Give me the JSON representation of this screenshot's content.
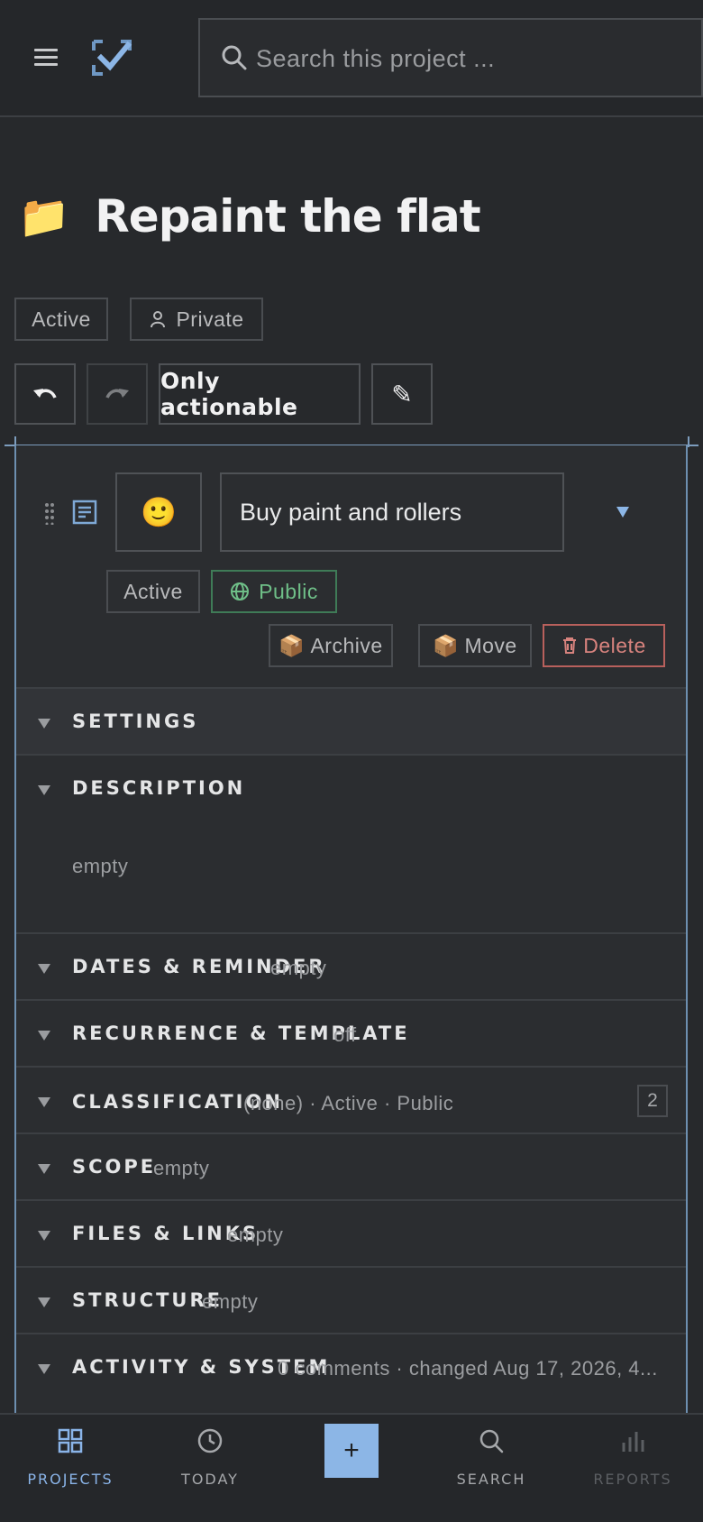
{
  "header": {
    "search_placeholder": "Search this project ..."
  },
  "project": {
    "title": "Repaint the flat",
    "status_chip": "Active",
    "visibility_chip": "Private"
  },
  "toolbar": {
    "filter_label": "Only actionable"
  },
  "task": {
    "name": "Buy paint and rollers",
    "emoji": "🙂",
    "status_chip": "Active",
    "visibility_chip": "Public",
    "archive_label": "Archive",
    "move_label": "Move",
    "delete_label": "Delete"
  },
  "sections": {
    "settings": {
      "title": "SETTINGS"
    },
    "description": {
      "title": "DESCRIPTION",
      "value": "empty"
    },
    "dates": {
      "title": "DATES & REMINDER",
      "value": "empty"
    },
    "recurrence": {
      "title": "RECURRENCE & TEMPLATE",
      "value": "off"
    },
    "classification": {
      "title": "CLASSIFICATION",
      "value": "(none) · Active · Public",
      "count": "2"
    },
    "scope": {
      "title": "SCOPE",
      "value": "empty"
    },
    "files": {
      "title": "FILES & LINKS",
      "value": "empty"
    },
    "structure": {
      "title": "STRUCTURE",
      "value": "empty"
    },
    "activity": {
      "title": "ACTIVITY & SYSTEM",
      "value": "0 comments · changed Aug 17, 2026, 4..."
    }
  },
  "nav": {
    "projects": "PROJECTS",
    "today": "TODAY",
    "add": "+",
    "search": "SEARCH",
    "reports": "REPORTS"
  },
  "colors": {
    "accent": "#8cb6e6",
    "public_green": "#6fbf88",
    "danger": "#d8837e",
    "background": "#27292c"
  }
}
